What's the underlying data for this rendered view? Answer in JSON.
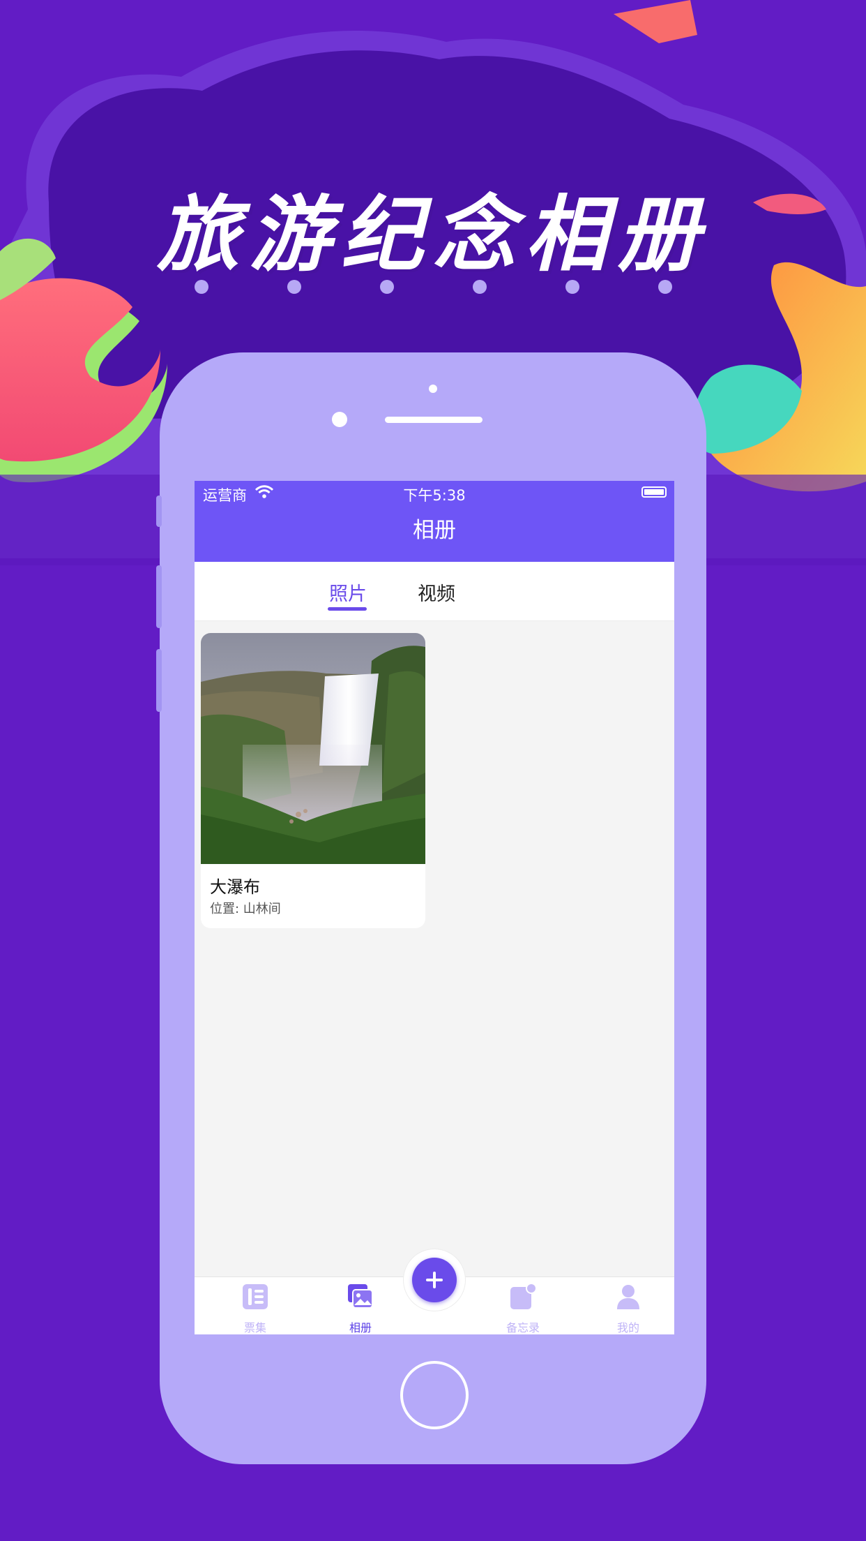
{
  "promo": {
    "title": "旅游纪念相册"
  },
  "status_bar": {
    "carrier": "运营商",
    "time": "下午5:38"
  },
  "nav": {
    "title": "相册"
  },
  "segments": {
    "items": [
      {
        "label": "照片",
        "selected": true
      },
      {
        "label": "视频",
        "selected": false
      }
    ]
  },
  "album": {
    "items": [
      {
        "title": "大瀑布",
        "location": "位置: 山林间"
      }
    ]
  },
  "tabbar": {
    "items": [
      {
        "label": "票集",
        "icon": "ticket-icon",
        "active": false
      },
      {
        "label": "相册",
        "icon": "album-icon",
        "active": true
      },
      {
        "label": "备忘录",
        "icon": "memo-icon",
        "active": false
      },
      {
        "label": "我的",
        "icon": "profile-icon",
        "active": false
      }
    ],
    "add_button_icon": "plus-icon"
  },
  "colors": {
    "background": "#621CC5",
    "phone_frame": "#B5A9F9",
    "accent": "#6E55F6",
    "tab_inactive": "#BFB3F7"
  }
}
